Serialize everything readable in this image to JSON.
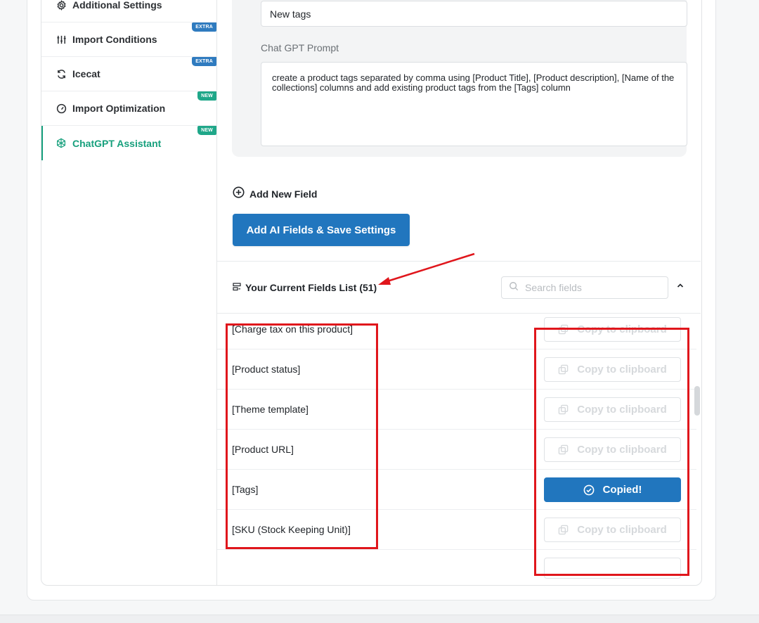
{
  "sidebar": {
    "items": [
      {
        "label": "Additional Settings",
        "icon": "gear-icon",
        "badge": ""
      },
      {
        "label": "Import Conditions",
        "icon": "sliders-icon",
        "badge": "EXTRA"
      },
      {
        "label": "Icecat",
        "icon": "refresh-icon",
        "badge": "EXTRA"
      },
      {
        "label": "Import Optimization",
        "icon": "gauge-icon",
        "badge": "NEW"
      },
      {
        "label": "ChatGPT Assistant",
        "icon": "openai-icon",
        "badge": "NEW"
      }
    ],
    "active_color": "#17a07d"
  },
  "form": {
    "tags_value": "New tags",
    "prompt_label": "Chat GPT Prompt",
    "prompt_value": "create a product tags separated by comma using [Product Title], [Product description], [Name of the collections] columns and add existing product tags from the [Tags] column",
    "add_field_label": "Add New Field",
    "save_label": "Add AI Fields & Save Settings"
  },
  "fields_list": {
    "title": "Your Current Fields List (51)",
    "search_placeholder": "Search fields",
    "copy_label": "Copy to clipboard",
    "copied_label": "Copied!",
    "rows": [
      {
        "name": "[Charge tax on this product]",
        "state": "copy"
      },
      {
        "name": "[Product status]",
        "state": "copy"
      },
      {
        "name": "[Theme template]",
        "state": "copy"
      },
      {
        "name": "[Product URL]",
        "state": "copy"
      },
      {
        "name": "[Tags]",
        "state": "copied"
      },
      {
        "name": "[SKU (Stock Keeping Unit)]",
        "state": "copy"
      }
    ]
  },
  "colors": {
    "primary": "#2176be",
    "annotation": "#e0161c",
    "badge_extra": "#2f7bbf",
    "badge_new": "#1fa789"
  }
}
